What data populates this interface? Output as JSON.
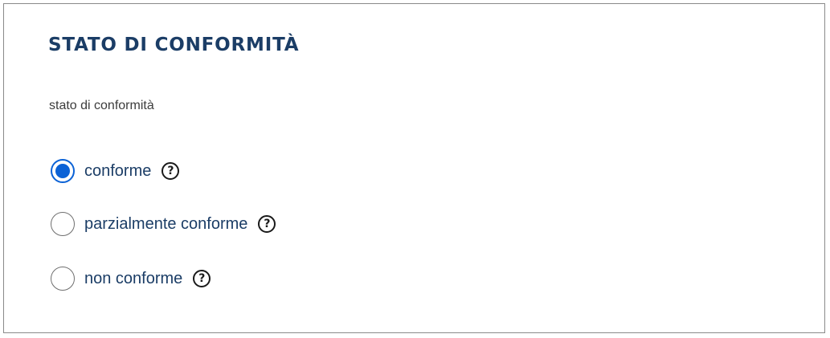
{
  "section": {
    "title": "STATO DI CONFORMITÀ",
    "group_label": "stato di conformità"
  },
  "options": [
    {
      "label": "conforme",
      "selected": true,
      "help_glyph": "?"
    },
    {
      "label": "parzialmente conforme",
      "selected": false,
      "help_glyph": "?"
    },
    {
      "label": "non conforme",
      "selected": false,
      "help_glyph": "?"
    }
  ],
  "colors": {
    "title": "#1b3d66",
    "accent": "#0b62d6",
    "border": "#8a8a8a"
  },
  "icons": {
    "help": "question-circle-icon"
  }
}
